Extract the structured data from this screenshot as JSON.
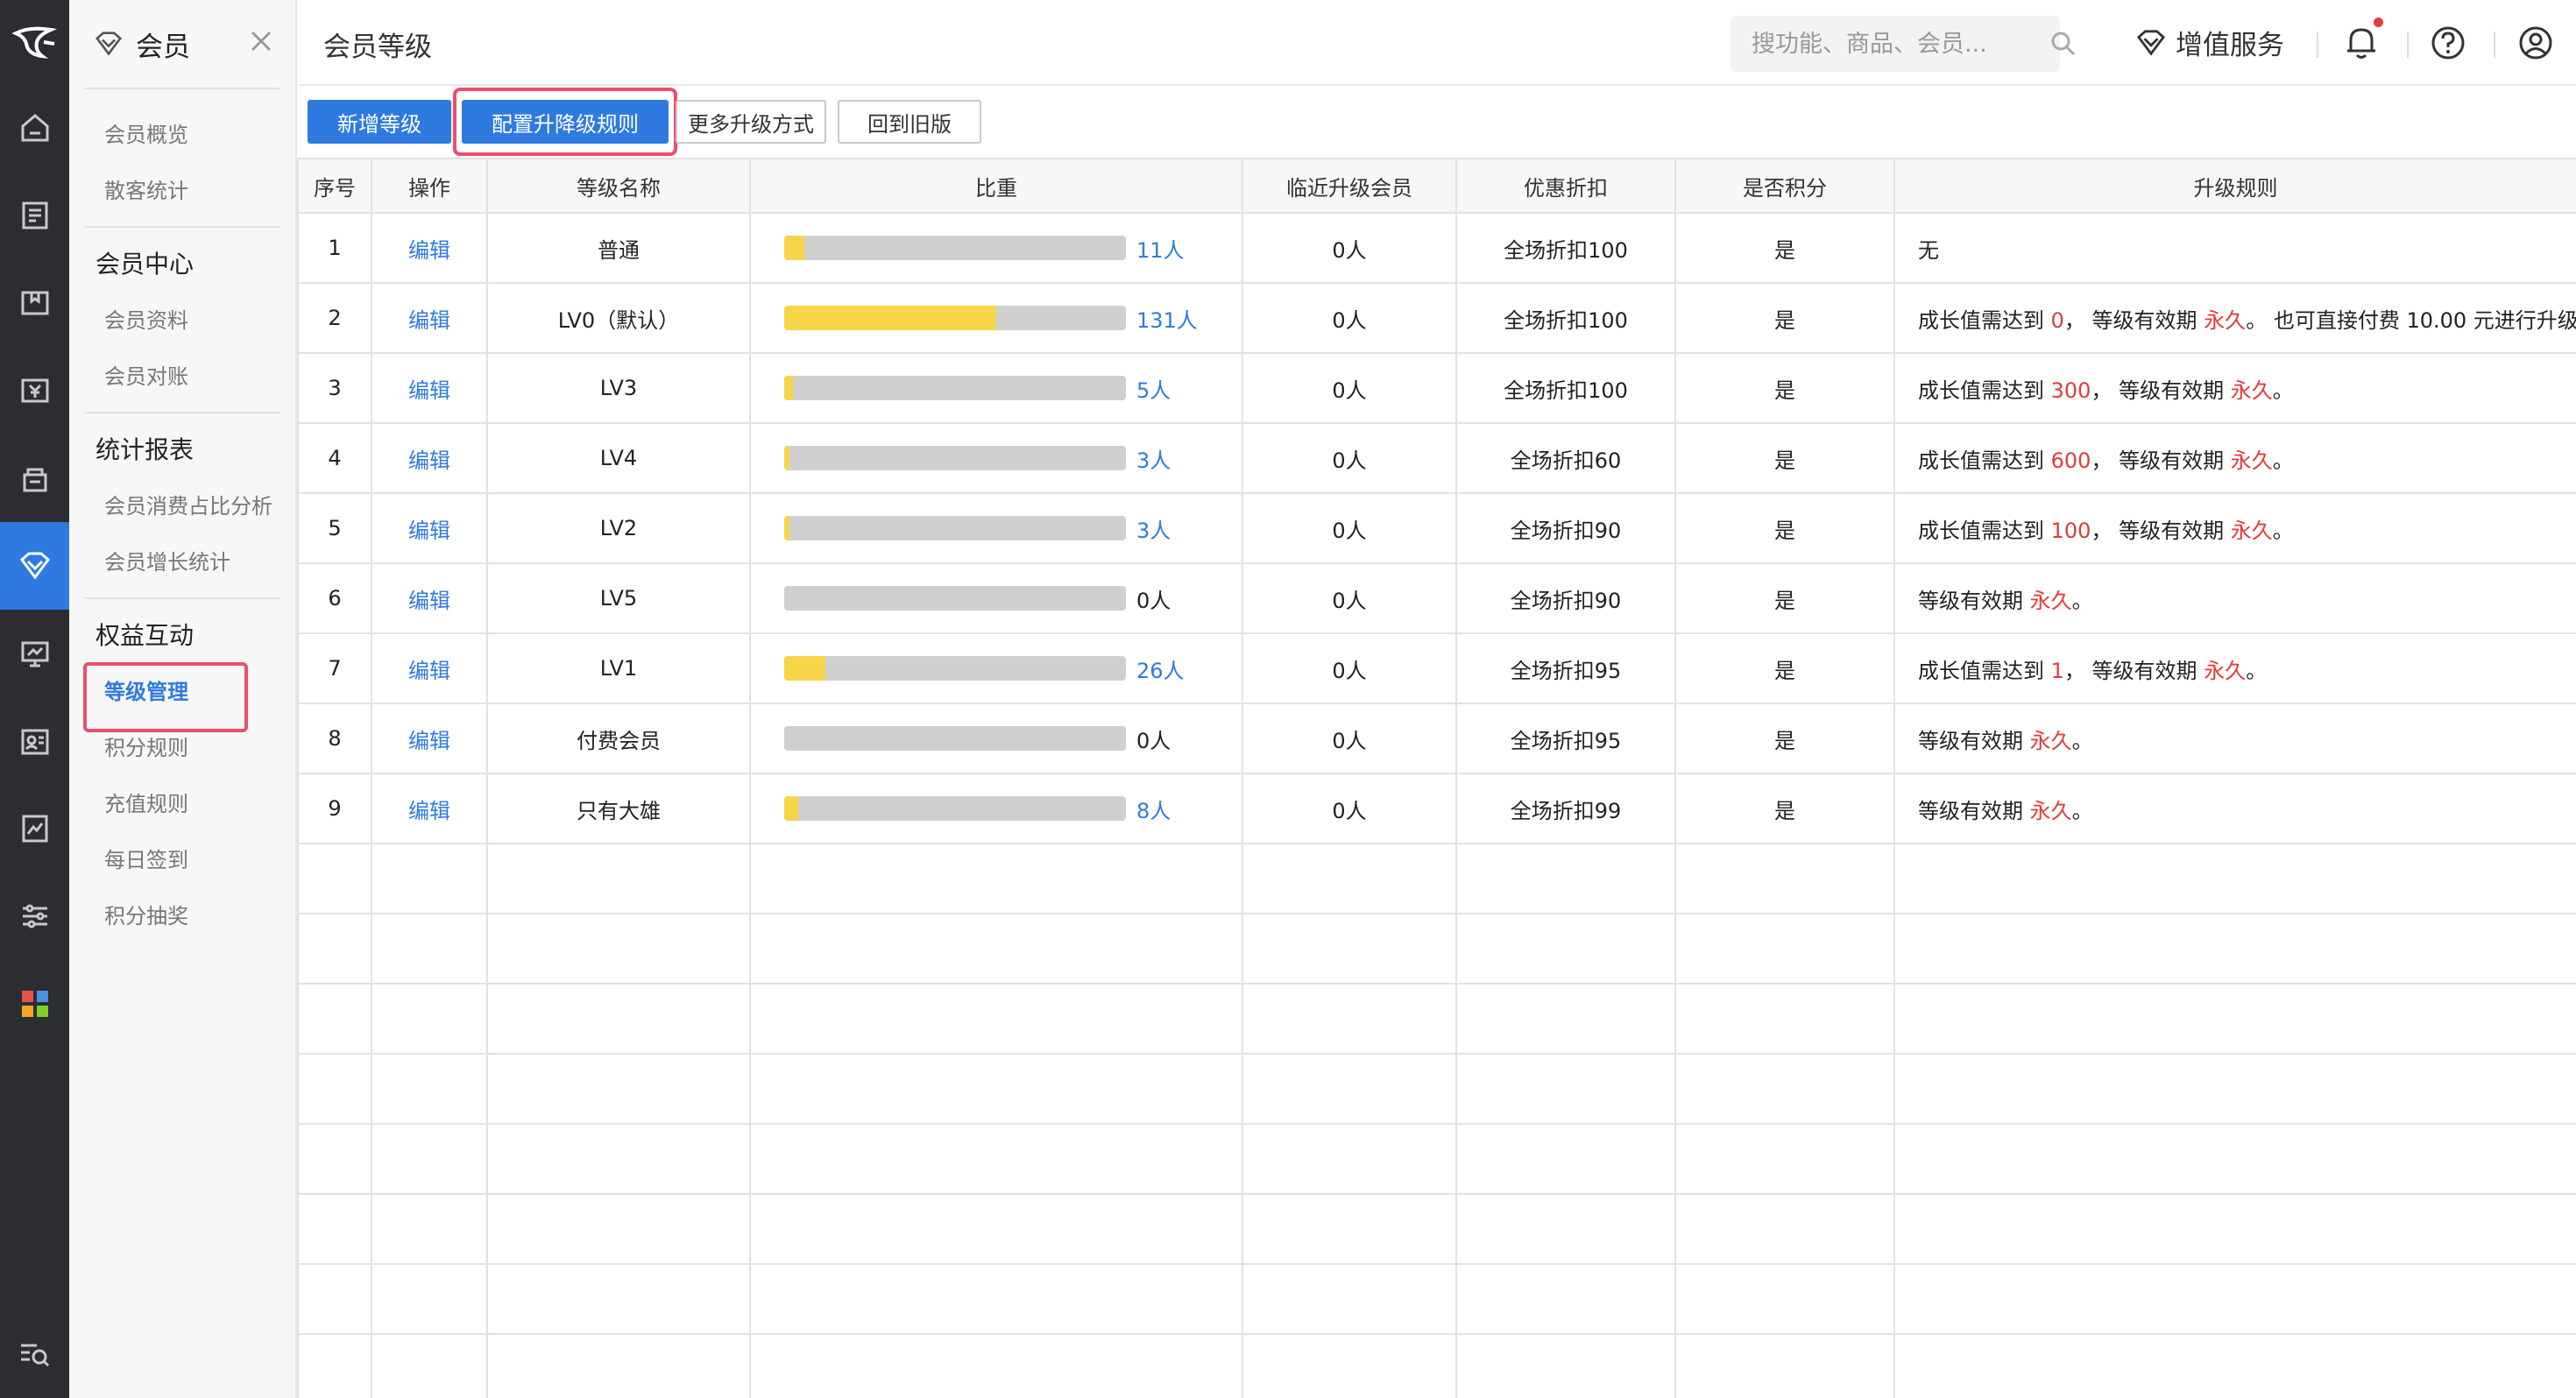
{
  "sidebar": {
    "title": "会员",
    "groups": [
      {
        "items": [
          "会员概览",
          "散客统计"
        ]
      },
      {
        "name": "会员中心",
        "items": [
          "会员资料",
          "会员对账"
        ]
      },
      {
        "name": "统计报表",
        "items": [
          "会员消费占比分析",
          "会员增长统计"
        ]
      },
      {
        "name": "权益互动",
        "items": [
          "等级管理",
          "积分规则",
          "充值规则",
          "每日签到",
          "积分抽奖"
        ]
      }
    ],
    "active_item": "等级管理"
  },
  "header": {
    "title": "会员等级",
    "search_placeholder": "搜功能、商品、会员...",
    "value_added_service": "增值服务"
  },
  "toolbar": {
    "add_level": "新增等级",
    "config_rules": "配置升降级规则",
    "more_methods": "更多升级方式",
    "back_old": "回到旧版"
  },
  "table": {
    "columns": [
      "序号",
      "操作",
      "等级名称",
      "比重",
      "临近升级会员",
      "优惠折扣",
      "是否积分",
      "升级规则"
    ],
    "rows": [
      {
        "no": "1",
        "action": "编辑",
        "name": "普通",
        "ratio": 0.06,
        "count": "11人",
        "near": "0人",
        "discount": "全场折扣100",
        "points": "是",
        "rule": [
          {
            "t": "无"
          }
        ]
      },
      {
        "no": "2",
        "action": "编辑",
        "name": "LV0（默认）",
        "ratio": 0.62,
        "count": "131人",
        "near": "0人",
        "discount": "全场折扣100",
        "points": "是",
        "rule": [
          {
            "t": "成长值需达到 "
          },
          {
            "t": "0",
            "red": true
          },
          {
            "t": "， 等级有效期 "
          },
          {
            "t": "永久",
            "red": true
          },
          {
            "t": "。 也可直接付费 10.00 元进行升级"
          }
        ]
      },
      {
        "no": "3",
        "action": "编辑",
        "name": "LV3",
        "ratio": 0.025,
        "count": "5人",
        "near": "0人",
        "discount": "全场折扣100",
        "points": "是",
        "rule": [
          {
            "t": "成长值需达到 "
          },
          {
            "t": "300",
            "red": true
          },
          {
            "t": "， 等级有效期 "
          },
          {
            "t": "永久",
            "red": true
          },
          {
            "t": "。"
          }
        ]
      },
      {
        "no": "4",
        "action": "编辑",
        "name": "LV4",
        "ratio": 0.015,
        "count": "3人",
        "near": "0人",
        "discount": "全场折扣60",
        "points": "是",
        "rule": [
          {
            "t": "成长值需达到 "
          },
          {
            "t": "600",
            "red": true
          },
          {
            "t": "， 等级有效期 "
          },
          {
            "t": "永久",
            "red": true
          },
          {
            "t": "。"
          }
        ]
      },
      {
        "no": "5",
        "action": "编辑",
        "name": "LV2",
        "ratio": 0.015,
        "count": "3人",
        "near": "0人",
        "discount": "全场折扣90",
        "points": "是",
        "rule": [
          {
            "t": "成长值需达到 "
          },
          {
            "t": "100",
            "red": true
          },
          {
            "t": "， 等级有效期 "
          },
          {
            "t": "永久",
            "red": true
          },
          {
            "t": "。"
          }
        ]
      },
      {
        "no": "6",
        "action": "编辑",
        "name": "LV5",
        "ratio": 0,
        "count": "0人",
        "near": "0人",
        "discount": "全场折扣90",
        "points": "是",
        "rule": [
          {
            "t": "等级有效期 "
          },
          {
            "t": "永久",
            "red": true
          },
          {
            "t": "。"
          }
        ]
      },
      {
        "no": "7",
        "action": "编辑",
        "name": "LV1",
        "ratio": 0.12,
        "count": "26人",
        "near": "0人",
        "discount": "全场折扣95",
        "points": "是",
        "rule": [
          {
            "t": "成长值需达到 "
          },
          {
            "t": "1",
            "red": true
          },
          {
            "t": "， 等级有效期 "
          },
          {
            "t": "永久",
            "red": true
          },
          {
            "t": "。"
          }
        ]
      },
      {
        "no": "8",
        "action": "编辑",
        "name": "付费会员",
        "ratio": 0,
        "count": "0人",
        "near": "0人",
        "discount": "全场折扣95",
        "points": "是",
        "rule": [
          {
            "t": "等级有效期 "
          },
          {
            "t": "永久",
            "red": true
          },
          {
            "t": "。"
          }
        ]
      },
      {
        "no": "9",
        "action": "编辑",
        "name": "只有大雄",
        "ratio": 0.04,
        "count": "8人",
        "near": "0人",
        "discount": "全场折扣99",
        "points": "是",
        "rule": [
          {
            "t": "等级有效期 "
          },
          {
            "t": "永久",
            "red": true
          },
          {
            "t": "。"
          }
        ]
      }
    ]
  },
  "rail_icons": [
    "logo-icon",
    "home-icon",
    "report-icon",
    "product-icon",
    "finance-icon",
    "marketing-icon",
    "member-icon",
    "monitor-icon",
    "staff-icon",
    "data-icon",
    "settings-icon",
    "apps-icon"
  ],
  "colors": {
    "accent": "#2f7ae0",
    "bar_fill": "#f7d548",
    "bar_bg": "#cfcfcf",
    "highlight": "#ee4d6b",
    "red_text": "#e23b3b"
  }
}
